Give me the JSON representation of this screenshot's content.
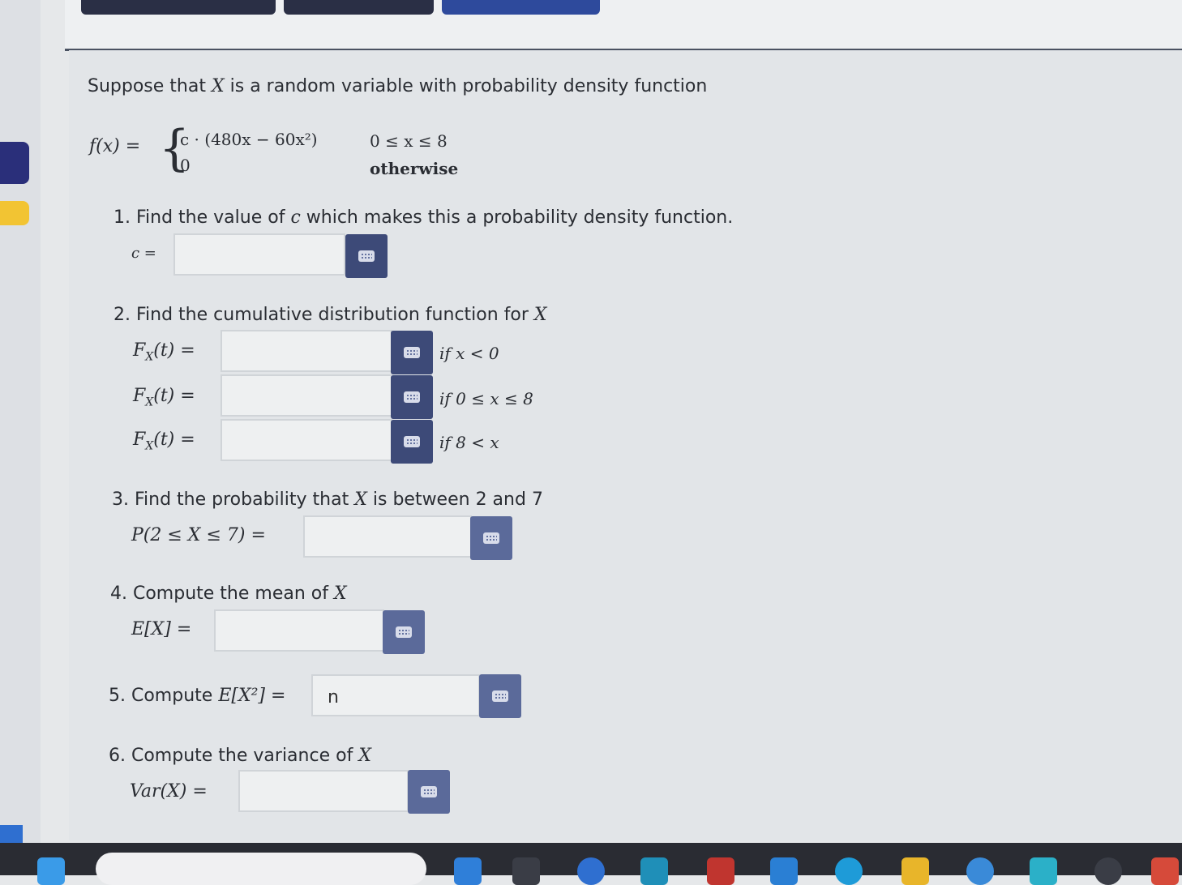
{
  "problem": {
    "intro_prefix": "Suppose that",
    "intro_var": "X",
    "intro_suffix": "is a random variable with probability density function",
    "pdf_lhs": "f(x) =",
    "pdf_case1_expr": "c · (480x − 60x²)",
    "pdf_case1_cond": "0 ≤ x ≤ 8",
    "pdf_case2_expr": "0",
    "pdf_case2_cond": "otherwise"
  },
  "questions": {
    "q1": {
      "text_before": "1. Find the value of",
      "var": "c",
      "text_after": "which makes this a probability density function.",
      "label": "c =",
      "value": ""
    },
    "q2": {
      "text": "2. Find the cumulative distribution function for",
      "var": "X",
      "rows": [
        {
          "label": "F",
          "sub": "X",
          "arg": "(t) =",
          "value": "",
          "cond": "if x < 0"
        },
        {
          "label": "F",
          "sub": "X",
          "arg": "(t) =",
          "value": "",
          "cond": "if 0 ≤ x ≤ 8"
        },
        {
          "label": "F",
          "sub": "X",
          "arg": "(t) =",
          "value": "",
          "cond": "if 8 < x"
        }
      ]
    },
    "q3": {
      "text_before": "3. Find the probability that",
      "var": "X",
      "text_after": "is between 2 and 7",
      "label": "P(2 ≤ X ≤ 7) =",
      "value": ""
    },
    "q4": {
      "text": "4. Compute the mean of",
      "var": "X",
      "label": "E[X] =",
      "value": ""
    },
    "q5": {
      "text": "5. Compute",
      "label": "E[X²] =",
      "value": "n"
    },
    "q6": {
      "text": "6. Compute the variance of",
      "var": "X",
      "label": "Var(X) =",
      "value": ""
    }
  },
  "colors": {
    "keypad_button": "#3d4a78",
    "top_button": "#2e4a9c",
    "left_tab_active": "#2a2f7a",
    "left_tab_flag": "#f2c433"
  },
  "icons": {
    "keypad": "keyboard-icon"
  }
}
